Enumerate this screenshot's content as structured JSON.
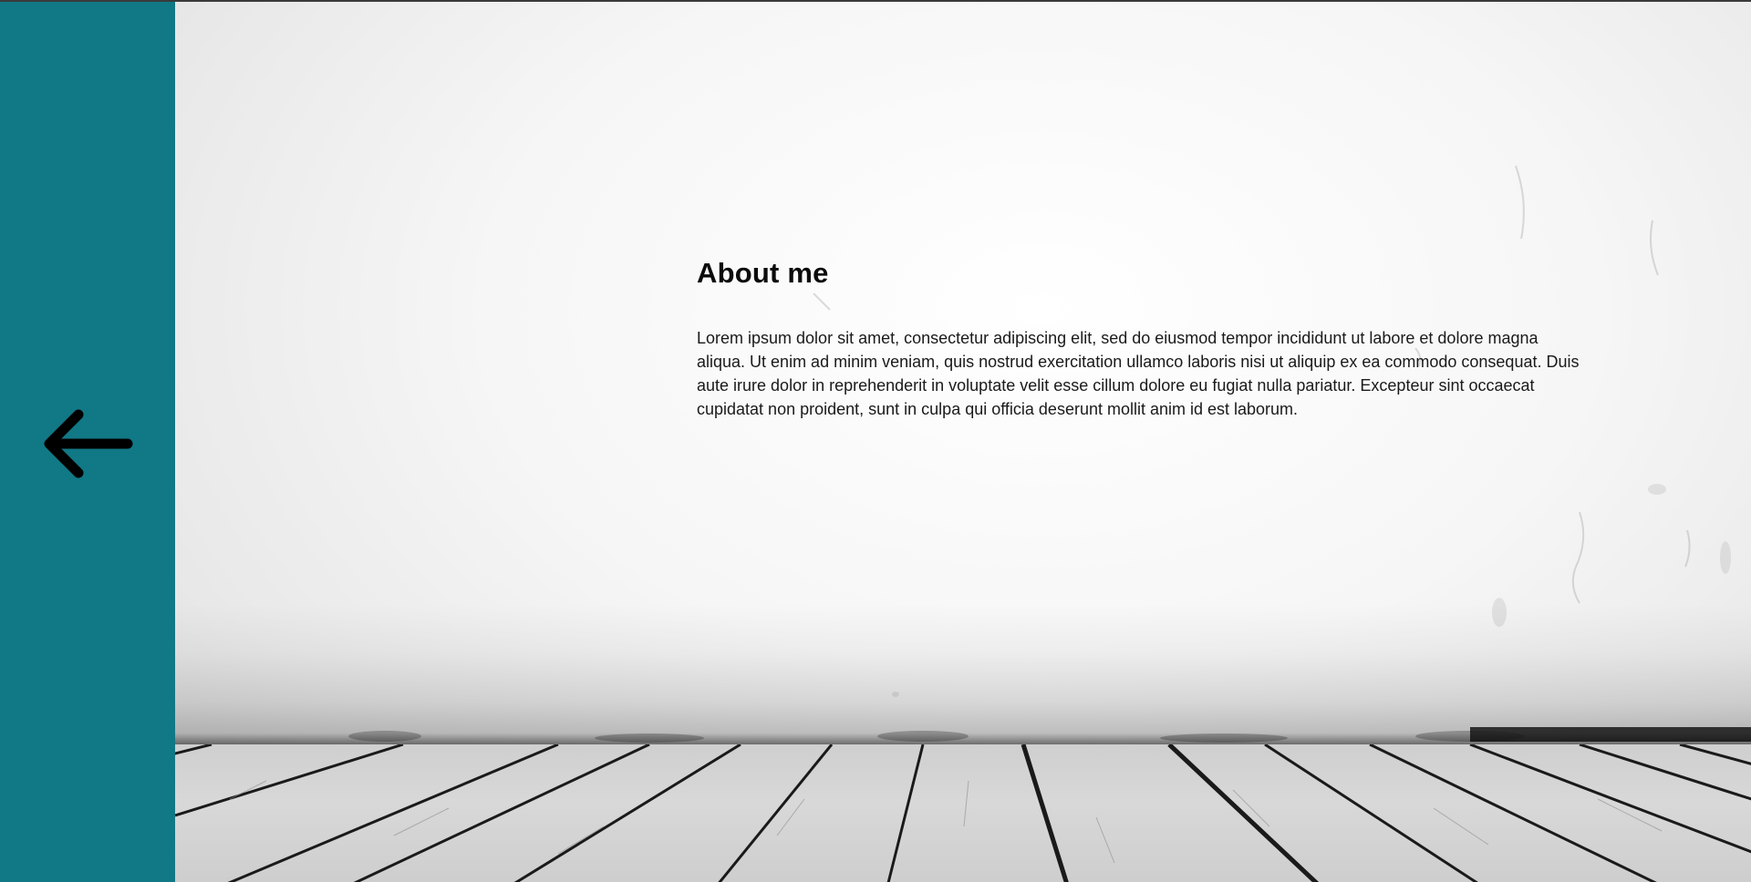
{
  "colors": {
    "sidebar": "#117886",
    "arrow": "#000000",
    "text": "#111111"
  },
  "nav": {
    "back_icon": "arrow-left-icon"
  },
  "about": {
    "heading": "About me",
    "body": "Lorem ipsum dolor sit amet, consectetur adipiscing elit, sed do eiusmod tempor incididunt ut labore et dolore magna aliqua. Ut enim ad minim veniam, quis nostrud exercitation ullamco laboris nisi ut aliquip ex ea commodo consequat. Duis aute irure dolor in reprehenderit in voluptate velit esse cillum dolore eu fugiat nulla pariatur. Excepteur sint occaecat cupidatat non proident, sunt in culpa qui officia deserunt mollit anim id est laborum."
  }
}
